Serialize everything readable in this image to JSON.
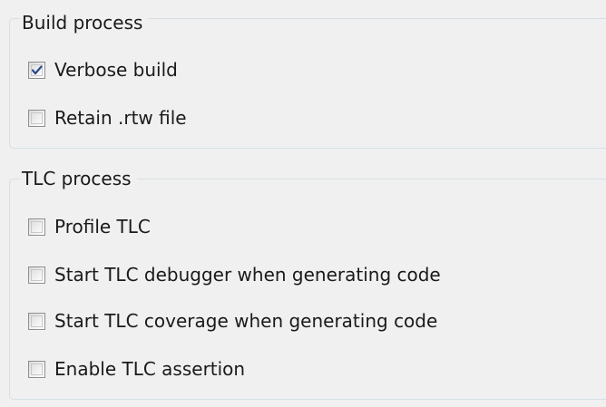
{
  "build_process": {
    "title": "Build process",
    "options": [
      {
        "label": "Verbose build",
        "checked": true
      },
      {
        "label": "Retain .rtw file",
        "checked": false
      }
    ]
  },
  "tlc_process": {
    "title": "TLC process",
    "options": [
      {
        "label": "Profile TLC",
        "checked": false
      },
      {
        "label": "Start TLC debugger when generating code",
        "checked": false
      },
      {
        "label": "Start TLC coverage when generating code",
        "checked": false
      },
      {
        "label": "Enable TLC assertion",
        "checked": false
      }
    ]
  },
  "colors": {
    "background": "#f0f0f0",
    "group_border": "#d5dfe5",
    "checkmark": "#2a4a8c"
  }
}
